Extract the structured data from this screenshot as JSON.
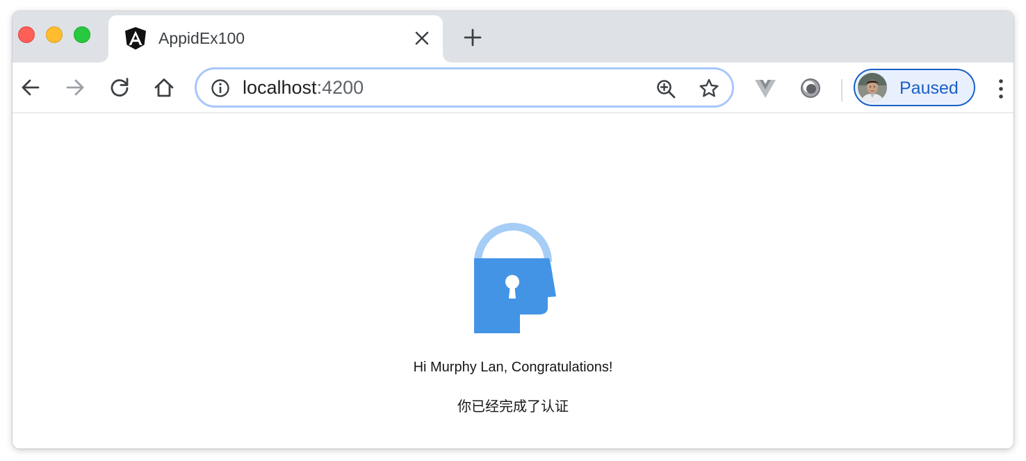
{
  "window": {
    "controls": [
      "close",
      "minimize",
      "zoom"
    ]
  },
  "tab": {
    "title": "AppidEx100",
    "favicon": "angular-icon"
  },
  "address_bar": {
    "host": "localhost",
    "port": ":4200"
  },
  "toolbar": {
    "icons": [
      "back-icon",
      "forward-icon",
      "reload-icon",
      "home-icon",
      "info-icon",
      "zoom-icon",
      "star-icon",
      "vue-devtools-icon",
      "extension-icon",
      "menu-icon"
    ]
  },
  "profile": {
    "label": "Paused"
  },
  "page": {
    "greeting": "Hi Murphy Lan, Congratulations!",
    "auth_message": "你已经完成了认证"
  },
  "colors": {
    "lock_body": "#4394e5",
    "lock_shackle": "#a6cdf5",
    "accent": "#1a5fc4"
  }
}
